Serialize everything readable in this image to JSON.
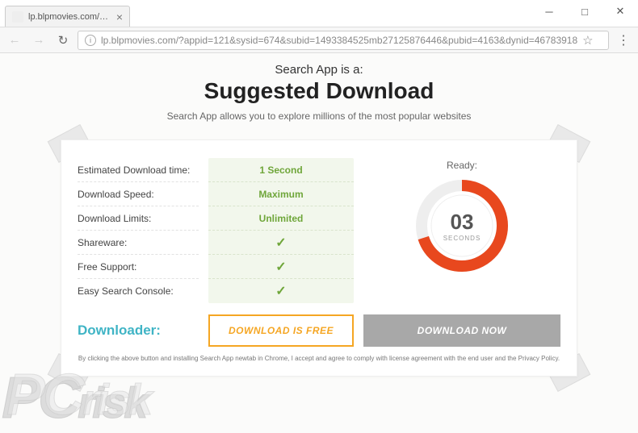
{
  "window": {
    "tab_title": "lp.blpmovies.com/?appi...",
    "url": "lp.blpmovies.com/?appid=121&sysid=674&subid=1493384525mb27125876446&pubid=4163&dynid=46783918"
  },
  "hero": {
    "pre": "Search App is a:",
    "title": "Suggested Download",
    "sub": "Search App allows you to explore millions of the most popular websites"
  },
  "labels": {
    "estimated": "Estimated Download time:",
    "speed": "Download Speed:",
    "limits": "Download Limits:",
    "shareware": "Shareware:",
    "support": "Free Support:",
    "console": "Easy Search Console:"
  },
  "values": {
    "estimated": "1 Second",
    "speed": "Maximum",
    "limits": "Unlimited",
    "check": "✓"
  },
  "ready": {
    "label": "Ready:",
    "count": "03",
    "unit": "SECONDS"
  },
  "buttons": {
    "downloader": "Downloader:",
    "free": "DOWNLOAD IS FREE",
    "now": "DOWNLOAD NOW"
  },
  "disclaimer": "By clicking the above button and installing Search App newtab in Chrome, I accept and agree to comply with license agreement with the end user and the Privacy Policy.",
  "watermark": {
    "pc": "PC",
    "risk": "risk"
  }
}
